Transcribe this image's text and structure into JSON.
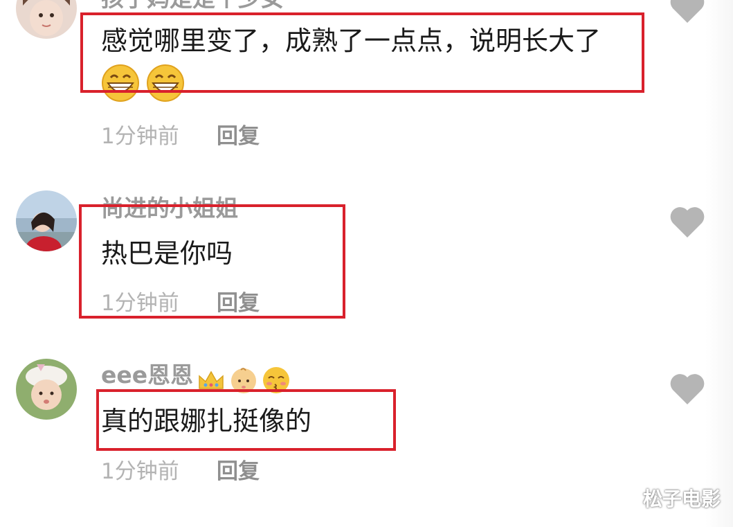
{
  "comments": [
    {
      "username": "孩子妈是是个少女",
      "text": "感觉哪里变了，成熟了一点点，说明长大了",
      "time": "1分钟前",
      "reply": "回复"
    },
    {
      "username": "尚进的小姐姐",
      "text": "热巴是你吗",
      "time": "1分钟前",
      "reply": "回复"
    },
    {
      "username": "eee恩恩",
      "text": "真的跟娜扎挺像的",
      "time": "1分钟前",
      "reply": "回复"
    }
  ],
  "watermark": "松子电影",
  "colors": {
    "highlight": "#d9212c",
    "heart": "#b5b5b5",
    "username": "#9a9a9a"
  },
  "icons": [
    "heart-icon",
    "grin-emoji",
    "crown-emoji",
    "baby-emoji",
    "kiss-emoji"
  ]
}
